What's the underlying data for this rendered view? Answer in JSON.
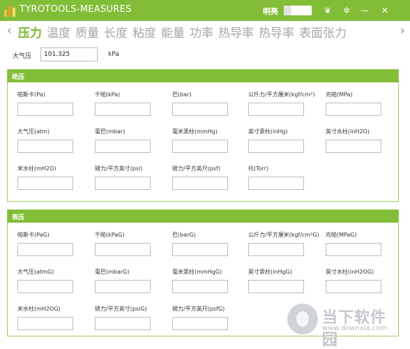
{
  "window": {
    "title": "TYROTOOLS-MEASURES",
    "theme_label": "明亮",
    "buttons": [
      {
        "name": "skin-button",
        "icon": "shirt-icon",
        "glyph": "❦"
      },
      {
        "name": "settings-button",
        "icon": "gear-icon",
        "glyph": "✲"
      },
      {
        "name": "minimize-button",
        "icon": "minimize-icon",
        "glyph": "—"
      },
      {
        "name": "close-button",
        "icon": "close-icon",
        "glyph": "✕"
      }
    ]
  },
  "colors": {
    "accent": "#82bd37",
    "tab_active": "#7ab733",
    "tab_inactive": "#a6a6a6"
  },
  "nav": {
    "prev": "‹",
    "next": "›"
  },
  "tabs": [
    "压力",
    "温度",
    "质量",
    "长度",
    "粘度",
    "能量",
    "功率",
    "热导率",
    "热导率",
    "表面张力"
  ],
  "active_tab": 0,
  "atmosphere": {
    "label": "大气压",
    "value": "101.325",
    "unit": "kPa"
  },
  "absolute": {
    "title": "绝压",
    "fields": [
      "帕斯卡(Pa)",
      "千帕(kPa)",
      "巴(bar)",
      "公斤力/平方厘米(kgf/cm²)",
      "兆帕(MPa)",
      "大气压(atm)",
      "毫巴(mbar)",
      "毫米汞柱(mmHg)",
      "英寸汞柱(inHg)",
      "英寸水柱(inH2O)",
      "米水柱(mH2O)",
      "磅力/平方英寸(psi)",
      "磅力/平方英尺(psf)",
      "托(Torr)"
    ]
  },
  "gauge": {
    "title": "表压",
    "fields": [
      "帕斯卡(PaG)",
      "千帕(kPaG)",
      "巴(barG)",
      "公斤力/平方厘米(kgf/cm²G)",
      "兆帕(MPaG)",
      "大气压(atmG)",
      "毫巴(mbarG)",
      "毫米汞柱(mmHgG)",
      "英寸汞柱(inHgG)",
      "英寸水柱(inH2OG)",
      "米水柱(mH2OG)",
      "磅力/平方英寸(psiG)",
      "磅力/平方英尺(psfG)"
    ]
  },
  "watermark": {
    "name": "当下软件园",
    "url": "www.downxia.com"
  }
}
